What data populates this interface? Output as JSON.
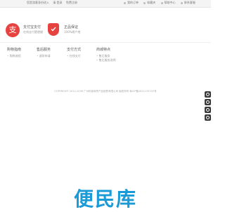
{
  "topbar": {
    "left_links": [
      "您是游客身份进入",
      "请 登录",
      "免费注册"
    ],
    "right_links": [
      "我的订单",
      "收藏夹",
      "帮助中心",
      "联系客服"
    ]
  },
  "features": [
    {
      "title": "支付宝支付",
      "subtitle": "在线支付更便捷"
    },
    {
      "title": "正品保证",
      "subtitle": "100%原产地"
    }
  ],
  "footer_columns": [
    {
      "heading": "购物指南",
      "links": [
        "购物流程"
      ]
    },
    {
      "heading": "售后服务",
      "links": [
        "退款申请"
      ]
    },
    {
      "heading": "支付方式",
      "links": [
        "在线支付"
      ]
    },
    {
      "heading": "商城特点",
      "links": [
        "售后服务",
        "售后服务说明"
      ]
    }
  ],
  "copyright": "COPYRIGHT 2012-2036 广州科普商贸产品销售有限公司 版权所有 粤ICP备2021133702号",
  "logo_text": "便民库",
  "colors": {
    "accent_red": "#e64340",
    "logo_blue": "#1a9ad6"
  }
}
